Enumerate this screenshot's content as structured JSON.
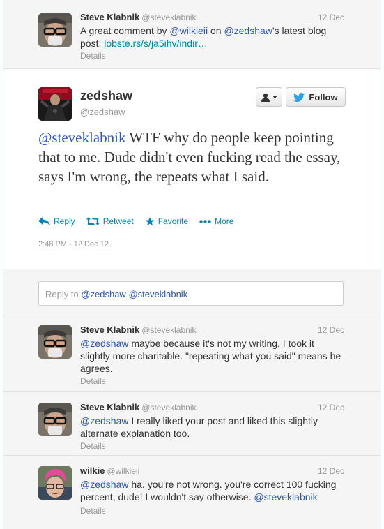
{
  "tweets_top": {
    "name": "Steve Klabnik",
    "handle": "@steveklabnik",
    "date": "12 Dec",
    "text_pre": "A great comment by ",
    "mention1": "@wilkieii",
    "text_mid": " on ",
    "mention2": "@zedshaw",
    "text_post": "'s latest blog post: ",
    "link": "lobste.rs/s/ja5ihv/indir…",
    "details": "Details"
  },
  "main": {
    "name": "zedshaw",
    "handle": "@zedshaw",
    "follow_label": "Follow",
    "mention": "@steveklabnik",
    "text": " WTF why do people keep pointing that to me. Dude didn't even fucking read the essay, says I'm wrong, the repeats what I said.",
    "actions": {
      "reply": "Reply",
      "retweet": "Retweet",
      "favorite": "Favorite",
      "more": "More"
    },
    "timestamp": "2:48 PM - 12 Dec 12"
  },
  "reply_box": {
    "placeholder": "Reply to ",
    "mention1": "@zedshaw",
    "mention2": "@steveklabnik"
  },
  "replies": [
    {
      "name": "Steve Klabnik",
      "handle": "@steveklabnik",
      "date": "12 Dec",
      "mention": "@zedshaw",
      "text": " maybe because it's not my writing, I took it slightly more charitable. \"repeating what you said\" means he agrees.",
      "details": "Details"
    },
    {
      "name": "Steve Klabnik",
      "handle": "@steveklabnik",
      "date": "12 Dec",
      "mention": "@zedshaw",
      "text": " I really liked your post and liked this slightly alternate explanation too.",
      "details": "Details"
    },
    {
      "name": "wilkie",
      "handle": "@wilkieii",
      "date": "12 Dec",
      "mention": "@zedshaw",
      "text": " ha. you're not wrong. you're correct 100 fucking percent, dude! I wouldn't say otherwise. ",
      "mention_end": "@steveklabnik",
      "details": "Details"
    }
  ],
  "colors": {
    "link": "#0084b4",
    "mention": "#2b56b6",
    "muted": "#999999",
    "row_bg": "#f5f5f5"
  }
}
